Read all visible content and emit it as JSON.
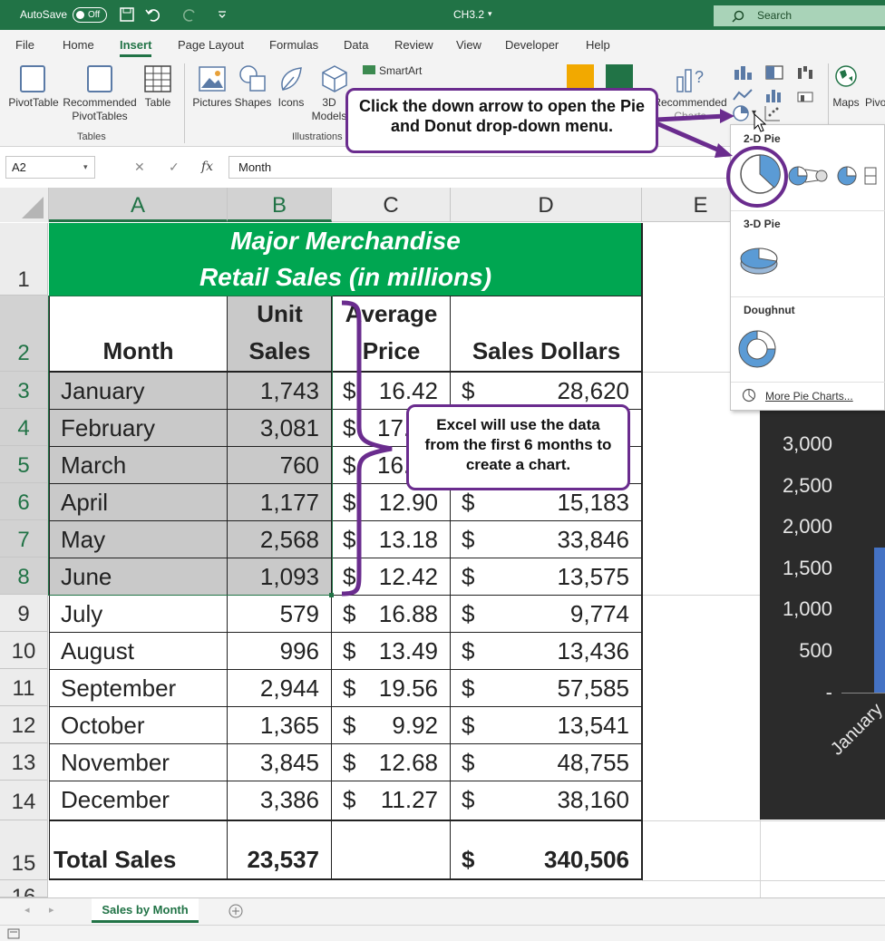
{
  "titlebar": {
    "autosave": "AutoSave",
    "toggle": "Off",
    "filename": "CH3.2",
    "search": "Search"
  },
  "menu": [
    "File",
    "Home",
    "Insert",
    "Page Layout",
    "Formulas",
    "Data",
    "Review",
    "View",
    "Developer",
    "Help"
  ],
  "ribbon": {
    "pivottable": "PivotTable",
    "recommended_pivot": [
      "Recommended",
      "PivotTables"
    ],
    "table": "Table",
    "tables_group": "Tables",
    "pictures": "Pictures",
    "shapes": "Shapes",
    "icons": "Icons",
    "models": [
      "3D",
      "Models"
    ],
    "smartart": "SmartArt",
    "illustrations_group": "Illustrations",
    "recommended_charts": [
      "Recommended",
      "Charts"
    ],
    "maps": "Maps",
    "pivot_partial": "Pivo"
  },
  "formula_bar": {
    "name_box": "A2",
    "fx": "fx",
    "value": "Month"
  },
  "columns": [
    "A",
    "B",
    "C",
    "D",
    "E"
  ],
  "rows": [
    "1",
    "2",
    "3",
    "4",
    "5",
    "6",
    "7",
    "8",
    "9",
    "10",
    "11",
    "12",
    "13",
    "14",
    "15",
    "16"
  ],
  "sheet": {
    "title_line1": "Major Merchandise",
    "title_line2": "Retail Sales (in millions)",
    "headers": {
      "month": "Month",
      "unit": "Unit",
      "sales": "Sales",
      "average": "Average",
      "price": "Price",
      "sales_dollars": "Sales Dollars"
    },
    "currency": "$",
    "data": [
      {
        "month": "January",
        "units": "1,743",
        "price": "16.42",
        "dollars": "28,620"
      },
      {
        "month": "February",
        "units": "3,081",
        "price": "17.",
        "dollars": ""
      },
      {
        "month": "March",
        "units": "760",
        "price": "16.",
        "dollars": ""
      },
      {
        "month": "April",
        "units": "1,177",
        "price": "12.90",
        "dollars": "15,183"
      },
      {
        "month": "May",
        "units": "2,568",
        "price": "13.18",
        "dollars": "33,846"
      },
      {
        "month": "June",
        "units": "1,093",
        "price": "12.42",
        "dollars": "13,575"
      },
      {
        "month": "July",
        "units": "579",
        "price": "16.88",
        "dollars": "9,774"
      },
      {
        "month": "August",
        "units": "996",
        "price": "13.49",
        "dollars": "13,436"
      },
      {
        "month": "September",
        "units": "2,944",
        "price": "19.56",
        "dollars": "57,585"
      },
      {
        "month": "October",
        "units": "1,365",
        "price": "9.92",
        "dollars": "13,541"
      },
      {
        "month": "November",
        "units": "3,845",
        "price": "12.68",
        "dollars": "48,755"
      },
      {
        "month": "December",
        "units": "3,386",
        "price": "11.27",
        "dollars": "38,160"
      }
    ],
    "total_label": "Total Sales",
    "total_units": "23,537",
    "total_dollars": "340,506"
  },
  "chart_partial": {
    "y_ticks": [
      "3,000",
      "2,500",
      "2,000",
      "1,500",
      "1,000",
      "500",
      "-"
    ],
    "x_label": "January"
  },
  "dropdown": {
    "pie2d": "2-D Pie",
    "pie3d": "3-D Pie",
    "doughnut": "Doughnut",
    "more": "More Pie Charts..."
  },
  "callouts": {
    "top": "Click the down arrow to open the Pie and Donut drop-down menu.",
    "middle": "Excel will use the data from the first 6 months to create a chart."
  },
  "sheet_tab": "Sales by Month",
  "colors": {
    "excel_green": "#217346",
    "banner_green": "#00a651",
    "callout_purple": "#6a2c8e",
    "selection_gray": "#c9c9c9"
  }
}
